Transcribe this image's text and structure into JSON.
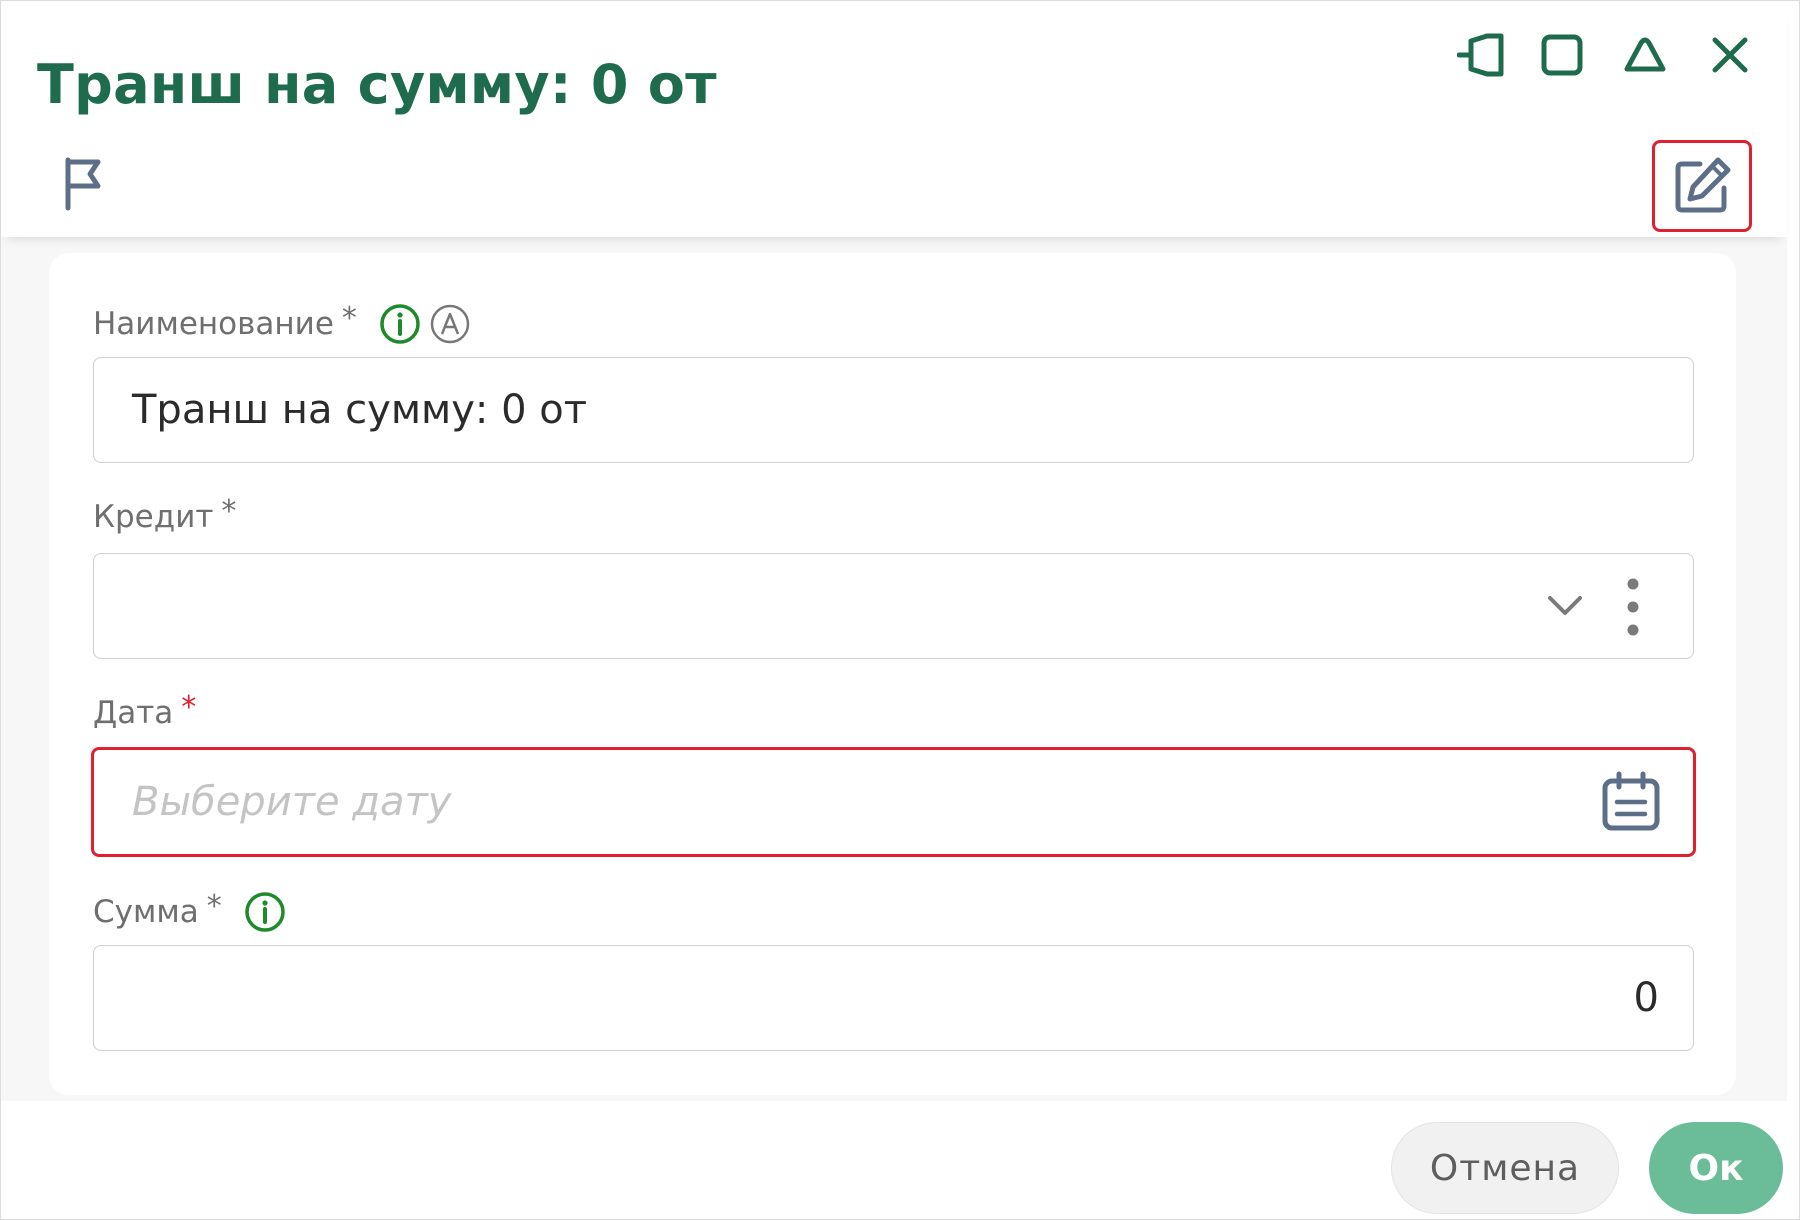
{
  "dialog": {
    "title": "Транш на сумму: 0 от"
  },
  "window_controls": {
    "icons": [
      "pin-icon",
      "maximize-icon",
      "collapse-icon",
      "close-icon"
    ]
  },
  "toolbar": {
    "flag_icon": "flag-icon",
    "edit_icon": "edit-icon"
  },
  "form": {
    "name": {
      "label": "Наименование",
      "required": "*",
      "value": "Транш на сумму: 0 от"
    },
    "credit": {
      "label": "Кредит",
      "required": "*",
      "value": ""
    },
    "date": {
      "label": "Дата",
      "required": "*",
      "placeholder": "Выберите дату"
    },
    "sum": {
      "label": "Сумма",
      "required": "*",
      "value": "0"
    }
  },
  "footer": {
    "cancel_label": "Отмена",
    "ok_label": "Ок"
  },
  "colors": {
    "title": "#1f6b4e",
    "info_icon": "#1e8a2a",
    "error": "#e0202e",
    "ok_button": "#6bbd99",
    "icon_slate": "#5d6f86"
  }
}
